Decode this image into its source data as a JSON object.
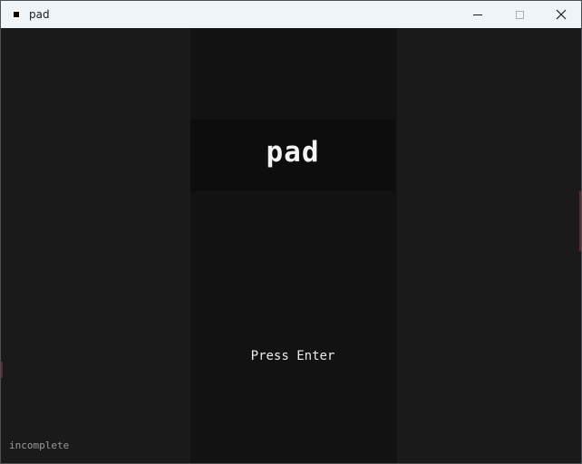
{
  "window": {
    "title": "pad",
    "icon": "app-icon",
    "controls": {
      "minimize_icon": "minimize-icon",
      "maximize_icon": "maximize-icon",
      "close_icon": "close-icon",
      "close_glyph": "✕"
    }
  },
  "game": {
    "title": "pad",
    "prompt": "Press Enter",
    "status": "incomplete"
  },
  "colors": {
    "background": "#1a1a1a",
    "center_column": "#121212",
    "title_band": "#0d0d0d",
    "text": "#f4f4f4",
    "status_text": "#9b9b9b",
    "titlebar": "#eef4f7"
  }
}
